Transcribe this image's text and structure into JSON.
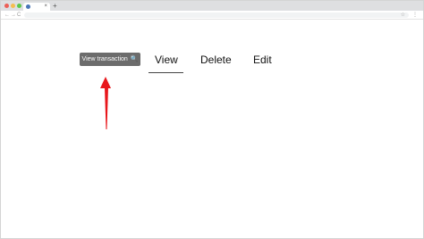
{
  "browser": {
    "tab_close": "×",
    "new_tab": "+",
    "nav_back": "←",
    "nav_forward": "→",
    "nav_reload": "C",
    "star": "☆",
    "menu": "⋮",
    "colors": {
      "close": "#ec5f57",
      "minimize": "#f5be4f",
      "zoom": "#5cc84a"
    }
  },
  "actions": {
    "view_transaction_label": "View transaction",
    "view_transaction_icon": "🔍",
    "view_label": "View",
    "delete_label": "Delete",
    "edit_label": "Edit"
  },
  "annotation": {
    "arrow_color": "#e8161b"
  }
}
